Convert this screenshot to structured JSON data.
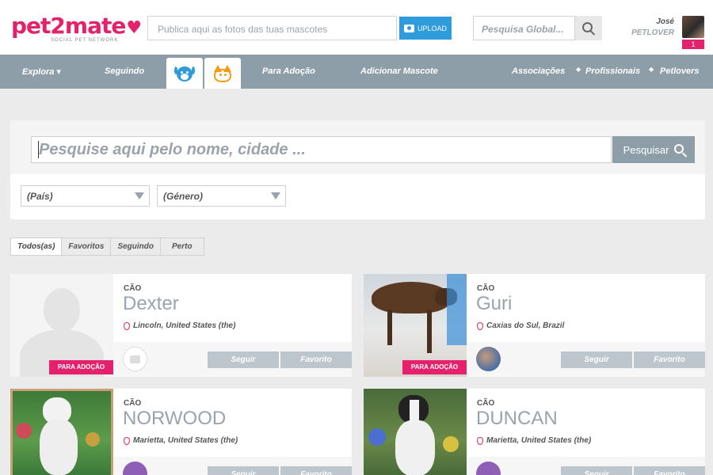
{
  "header": {
    "logo_text": "pet2mate",
    "logo_sub": "SOCIAL PET NETWORK",
    "upload_placeholder": "Publica aqui as fotos das tuas mascotes",
    "upload_label": "UPLOAD",
    "global_placeholder": "Pesquisa Global...",
    "user_name": "José",
    "user_role": "PETLOVER",
    "notifications": "1"
  },
  "nav": {
    "explore": "Explora ▾",
    "following": "Seguindo",
    "adoption": "Para Adoção",
    "add_pet": "Adicionar Mascote",
    "associations": "Associações",
    "professionals": "Profissionais",
    "petlovers": "Petlovers"
  },
  "search": {
    "placeholder": "Pesquise aqui pelo nome, cidade ...",
    "button": "Pesquisar",
    "country": "(País)",
    "gender": "(Género)"
  },
  "filters": [
    "Todos(as)",
    "Favoritos",
    "Seguindo",
    "Perto"
  ],
  "cards": [
    {
      "kind": "CÃO",
      "name": "Dexter",
      "location": "Lincoln, United States (the)",
      "follow": "Seguir",
      "favorite": "Favorito",
      "badge": "PARA ADOÇÃO"
    },
    {
      "kind": "CÃO",
      "name": "Guri",
      "location": "Caxias do Sul, Brazil",
      "follow": "Seguir",
      "favorite": "Favorito",
      "badge": "PARA ADOÇÃO"
    },
    {
      "kind": "CÃO",
      "name": "NORWOOD",
      "location": "Marietta, United States (the)",
      "follow": "Seguir",
      "favorite": "Favorito"
    },
    {
      "kind": "CÃO",
      "name": "DUNCAN",
      "location": "Marietta, United States (the)",
      "follow": "Seguir",
      "favorite": "Favorito"
    }
  ],
  "colors": {
    "brand": "#e6216b",
    "nav": "#8e9ea9",
    "upload": "#2e9bdb"
  }
}
